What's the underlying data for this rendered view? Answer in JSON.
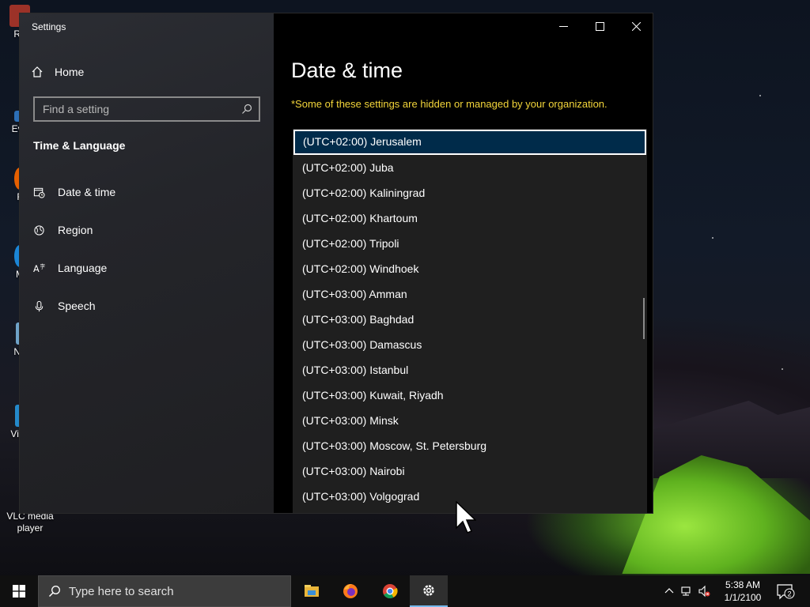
{
  "desktop": {
    "icons": [
      {
        "label": "Re",
        "icon": "recycle-bin-icon",
        "color": "#c0392b"
      },
      {
        "label": "Eve",
        "icon": "shortcut-icon",
        "color": "#2c6fb7"
      },
      {
        "label": "F",
        "icon": "firefox-icon",
        "color": "#e66000"
      },
      {
        "label": "M",
        "icon": "edge-icon",
        "color": "#1b86d6"
      },
      {
        "label": "No",
        "icon": "notepad-icon",
        "color": "#6fa3c8"
      },
      {
        "label": "Visu",
        "icon": "vscode-icon",
        "color": "#2489ca"
      },
      {
        "label": "VLC media player",
        "icon": "vlc-icon",
        "color": "#f08000"
      }
    ]
  },
  "settings": {
    "app_title": "Settings",
    "home_label": "Home",
    "search": {
      "placeholder": "Find a setting"
    },
    "section_title": "Time & Language",
    "nav_items": [
      {
        "label": "Date & time",
        "icon": "calendar-clock-icon"
      },
      {
        "label": "Region",
        "icon": "globe-icon"
      },
      {
        "label": "Language",
        "icon": "language-icon"
      },
      {
        "label": "Speech",
        "icon": "microphone-icon"
      }
    ],
    "page_title": "Date & time",
    "org_note": "*Some of these settings are hidden or managed by your organization.",
    "timezones": [
      "(UTC+02:00) Jerusalem",
      "(UTC+02:00) Juba",
      "(UTC+02:00) Kaliningrad",
      "(UTC+02:00) Khartoum",
      "(UTC+02:00) Tripoli",
      "(UTC+02:00) Windhoek",
      "(UTC+03:00) Amman",
      "(UTC+03:00) Baghdad",
      "(UTC+03:00) Damascus",
      "(UTC+03:00) Istanbul",
      "(UTC+03:00) Kuwait, Riyadh",
      "(UTC+03:00) Minsk",
      "(UTC+03:00) Moscow, St. Petersburg",
      "(UTC+03:00) Nairobi",
      "(UTC+03:00) Volgograd"
    ],
    "selected_timezone": "(UTC+02:00) Jerusalem"
  },
  "taskbar": {
    "search_placeholder": "Type here to search",
    "apps": [
      "file-explorer-icon",
      "firefox-icon",
      "chrome-icon",
      "settings-gear-icon"
    ],
    "active_app": "settings-gear-icon",
    "time": "5:38 AM",
    "date": "1/1/2100",
    "notification_count": "2"
  },
  "colors": {
    "selection_bg": "#002b4a",
    "note_text": "#f3d53a",
    "taskbar_active": "#76b9ed"
  }
}
